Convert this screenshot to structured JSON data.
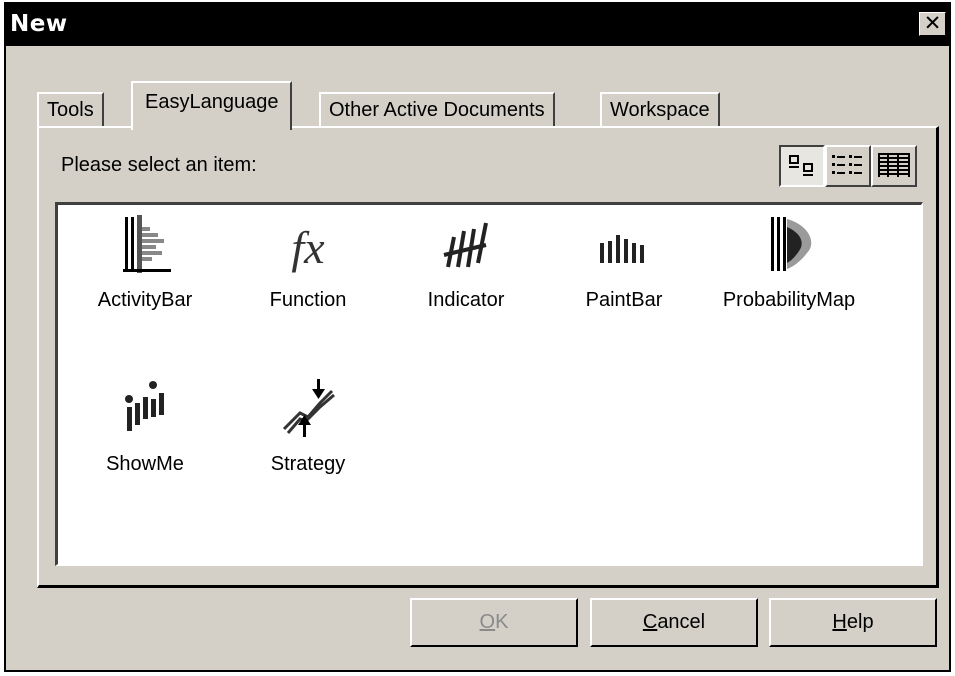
{
  "window": {
    "title": "New",
    "close_glyph": "✕"
  },
  "tabs": [
    {
      "label": "Tools",
      "active": false
    },
    {
      "label": "EasyLanguage",
      "active": true
    },
    {
      "label": "Other Active Documents",
      "active": false
    },
    {
      "label": "Workspace",
      "active": false
    }
  ],
  "panel": {
    "prompt": "Please select an item:",
    "view_modes": [
      {
        "name": "large-icons",
        "icon": "large-icons-view-icon",
        "selected": true
      },
      {
        "name": "list",
        "icon": "list-view-icon",
        "selected": false
      },
      {
        "name": "details",
        "icon": "details-view-icon",
        "selected": false
      }
    ]
  },
  "items": [
    {
      "label": "ActivityBar",
      "icon": "activitybar-icon"
    },
    {
      "label": "Function",
      "icon": "function-icon",
      "glyph": "fx"
    },
    {
      "label": "Indicator",
      "icon": "indicator-icon"
    },
    {
      "label": "PaintBar",
      "icon": "paintbar-icon"
    },
    {
      "label": "ProbabilityMap",
      "icon": "probabilitymap-icon"
    },
    {
      "label": "ShowMe",
      "icon": "showme-icon"
    },
    {
      "label": "Strategy",
      "icon": "strategy-icon"
    }
  ],
  "buttons": {
    "ok": {
      "mnemonic": "O",
      "rest": "K",
      "enabled": false
    },
    "cancel": {
      "mnemonic": "C",
      "rest": "ancel",
      "enabled": true
    },
    "help": {
      "mnemonic": "H",
      "rest": "elp",
      "enabled": true
    }
  },
  "colors": {
    "dialog_face": "#d4d0c8",
    "titlebar": "#000000",
    "listview_bg": "#ffffff",
    "disabled_text": "#8a8a8a"
  }
}
